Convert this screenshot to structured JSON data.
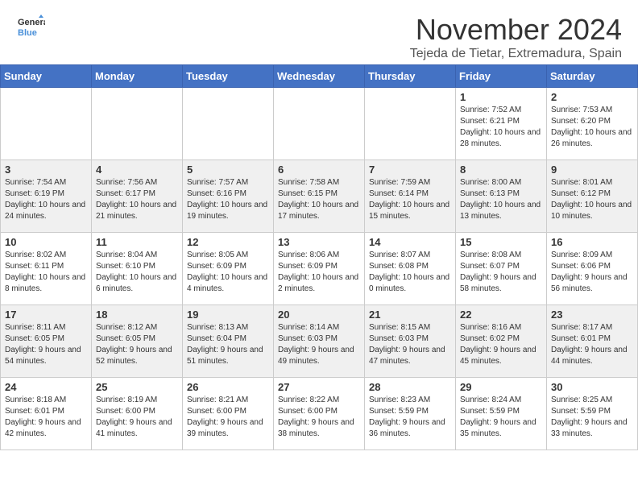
{
  "header": {
    "logo_line1": "General",
    "logo_line2": "Blue",
    "month": "November 2024",
    "location": "Tejeda de Tietar, Extremadura, Spain"
  },
  "weekdays": [
    "Sunday",
    "Monday",
    "Tuesday",
    "Wednesday",
    "Thursday",
    "Friday",
    "Saturday"
  ],
  "weeks": [
    [
      {
        "day": "",
        "info": ""
      },
      {
        "day": "",
        "info": ""
      },
      {
        "day": "",
        "info": ""
      },
      {
        "day": "",
        "info": ""
      },
      {
        "day": "",
        "info": ""
      },
      {
        "day": "1",
        "info": "Sunrise: 7:52 AM\nSunset: 6:21 PM\nDaylight: 10 hours and 28 minutes."
      },
      {
        "day": "2",
        "info": "Sunrise: 7:53 AM\nSunset: 6:20 PM\nDaylight: 10 hours and 26 minutes."
      }
    ],
    [
      {
        "day": "3",
        "info": "Sunrise: 7:54 AM\nSunset: 6:19 PM\nDaylight: 10 hours and 24 minutes."
      },
      {
        "day": "4",
        "info": "Sunrise: 7:56 AM\nSunset: 6:17 PM\nDaylight: 10 hours and 21 minutes."
      },
      {
        "day": "5",
        "info": "Sunrise: 7:57 AM\nSunset: 6:16 PM\nDaylight: 10 hours and 19 minutes."
      },
      {
        "day": "6",
        "info": "Sunrise: 7:58 AM\nSunset: 6:15 PM\nDaylight: 10 hours and 17 minutes."
      },
      {
        "day": "7",
        "info": "Sunrise: 7:59 AM\nSunset: 6:14 PM\nDaylight: 10 hours and 15 minutes."
      },
      {
        "day": "8",
        "info": "Sunrise: 8:00 AM\nSunset: 6:13 PM\nDaylight: 10 hours and 13 minutes."
      },
      {
        "day": "9",
        "info": "Sunrise: 8:01 AM\nSunset: 6:12 PM\nDaylight: 10 hours and 10 minutes."
      }
    ],
    [
      {
        "day": "10",
        "info": "Sunrise: 8:02 AM\nSunset: 6:11 PM\nDaylight: 10 hours and 8 minutes."
      },
      {
        "day": "11",
        "info": "Sunrise: 8:04 AM\nSunset: 6:10 PM\nDaylight: 10 hours and 6 minutes."
      },
      {
        "day": "12",
        "info": "Sunrise: 8:05 AM\nSunset: 6:09 PM\nDaylight: 10 hours and 4 minutes."
      },
      {
        "day": "13",
        "info": "Sunrise: 8:06 AM\nSunset: 6:09 PM\nDaylight: 10 hours and 2 minutes."
      },
      {
        "day": "14",
        "info": "Sunrise: 8:07 AM\nSunset: 6:08 PM\nDaylight: 10 hours and 0 minutes."
      },
      {
        "day": "15",
        "info": "Sunrise: 8:08 AM\nSunset: 6:07 PM\nDaylight: 9 hours and 58 minutes."
      },
      {
        "day": "16",
        "info": "Sunrise: 8:09 AM\nSunset: 6:06 PM\nDaylight: 9 hours and 56 minutes."
      }
    ],
    [
      {
        "day": "17",
        "info": "Sunrise: 8:11 AM\nSunset: 6:05 PM\nDaylight: 9 hours and 54 minutes."
      },
      {
        "day": "18",
        "info": "Sunrise: 8:12 AM\nSunset: 6:05 PM\nDaylight: 9 hours and 52 minutes."
      },
      {
        "day": "19",
        "info": "Sunrise: 8:13 AM\nSunset: 6:04 PM\nDaylight: 9 hours and 51 minutes."
      },
      {
        "day": "20",
        "info": "Sunrise: 8:14 AM\nSunset: 6:03 PM\nDaylight: 9 hours and 49 minutes."
      },
      {
        "day": "21",
        "info": "Sunrise: 8:15 AM\nSunset: 6:03 PM\nDaylight: 9 hours and 47 minutes."
      },
      {
        "day": "22",
        "info": "Sunrise: 8:16 AM\nSunset: 6:02 PM\nDaylight: 9 hours and 45 minutes."
      },
      {
        "day": "23",
        "info": "Sunrise: 8:17 AM\nSunset: 6:01 PM\nDaylight: 9 hours and 44 minutes."
      }
    ],
    [
      {
        "day": "24",
        "info": "Sunrise: 8:18 AM\nSunset: 6:01 PM\nDaylight: 9 hours and 42 minutes."
      },
      {
        "day": "25",
        "info": "Sunrise: 8:19 AM\nSunset: 6:00 PM\nDaylight: 9 hours and 41 minutes."
      },
      {
        "day": "26",
        "info": "Sunrise: 8:21 AM\nSunset: 6:00 PM\nDaylight: 9 hours and 39 minutes."
      },
      {
        "day": "27",
        "info": "Sunrise: 8:22 AM\nSunset: 6:00 PM\nDaylight: 9 hours and 38 minutes."
      },
      {
        "day": "28",
        "info": "Sunrise: 8:23 AM\nSunset: 5:59 PM\nDaylight: 9 hours and 36 minutes."
      },
      {
        "day": "29",
        "info": "Sunrise: 8:24 AM\nSunset: 5:59 PM\nDaylight: 9 hours and 35 minutes."
      },
      {
        "day": "30",
        "info": "Sunrise: 8:25 AM\nSunset: 5:59 PM\nDaylight: 9 hours and 33 minutes."
      }
    ]
  ]
}
